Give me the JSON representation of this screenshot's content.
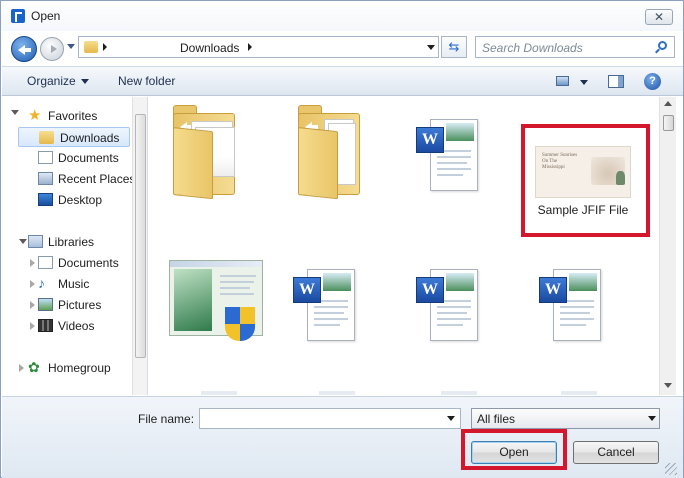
{
  "window": {
    "title": "Open",
    "close_glyph": "✕"
  },
  "address": {
    "segments": [
      "Downloads"
    ],
    "search_placeholder": "Search Downloads"
  },
  "toolbar": {
    "organize_label": "Organize",
    "new_folder_label": "New folder",
    "help_glyph": "?"
  },
  "sidebar": {
    "favorites": {
      "label": "Favorites",
      "items": [
        {
          "label": "Downloads",
          "icon": "downloads-folder-icon",
          "selected": true
        },
        {
          "label": "Documents",
          "icon": "documents-icon"
        },
        {
          "label": "Recent Places",
          "icon": "recent-places-icon"
        },
        {
          "label": "Desktop",
          "icon": "desktop-icon"
        }
      ]
    },
    "libraries": {
      "label": "Libraries",
      "items": [
        {
          "label": "Documents",
          "icon": "documents-library-icon"
        },
        {
          "label": "Music",
          "icon": "music-icon"
        },
        {
          "label": "Pictures",
          "icon": "pictures-icon"
        },
        {
          "label": "Videos",
          "icon": "videos-icon"
        }
      ]
    },
    "homegroup": {
      "label": "Homegroup",
      "icon": "homegroup-icon"
    }
  },
  "files": {
    "items": [
      {
        "type": "folder",
        "icon": "folder-icon",
        "label": ""
      },
      {
        "type": "folder",
        "icon": "folder-icon",
        "label": ""
      },
      {
        "type": "word-document",
        "icon": "word-document-icon",
        "label": ""
      },
      {
        "type": "image",
        "icon": "jfif-thumbnail",
        "label": "Sample JFIF File",
        "thumbnail_text": "Summer Sunrises\nOn The\nMississippi",
        "highlighted": true
      },
      {
        "type": "installer",
        "icon": "setup-shield-icon",
        "label": ""
      },
      {
        "type": "word-document",
        "icon": "word-document-icon",
        "label": ""
      },
      {
        "type": "word-document",
        "icon": "word-document-icon",
        "label": ""
      },
      {
        "type": "word-document",
        "icon": "word-document-icon",
        "label": ""
      }
    ],
    "word_badge_letter": "W"
  },
  "bottom": {
    "file_name_label": "File name:",
    "file_name_value": "",
    "file_type_selected": "All files",
    "open_label": "Open",
    "cancel_label": "Cancel"
  },
  "highlight_color": "#d4172d"
}
